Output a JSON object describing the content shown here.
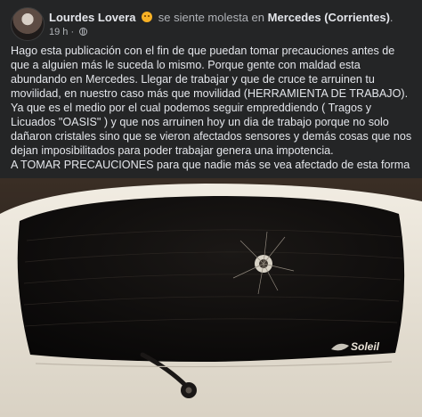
{
  "post": {
    "author": "Lourdes Lovera",
    "feeling_text": "se siente molesta en",
    "location": "Mercedes (Corrientes)",
    "period": ".",
    "timestamp": "19 h",
    "separator": "·",
    "feeling_icon": "angry-face-emoji",
    "privacy_icon": "globe-icon",
    "body_paragraphs": [
      "Hago esta publicación con el fin de que puedan tomar precauciones antes de que a alguien más le suceda lo mismo. Porque gente con maldad esta abundando en Mercedes. Llegar de trabajar y que de cruce te arruinen tu movilidad, en nuestro caso más que movilidad (HERRAMIENTA DE TRABAJO). Ya que es el medio por el cual podemos seguir empreddiendo ( Tragos y Licuados \"OASIS\" ) y que nos arruinen hoy un dia de trabajo porque no solo dañaron cristales sino que se vieron afectados sensores y demás cosas que nos dejan imposibilitados para poder trabajar genera una impotencia.",
      "A TOMAR  PRECAUCIONES para que nadie más se vea afectado de esta forma"
    ]
  },
  "photo": {
    "logo_text": "Soleil",
    "colors": {
      "background": "#242526",
      "car_body": "#e9e3d7",
      "glass": "#0c0b0a"
    }
  }
}
